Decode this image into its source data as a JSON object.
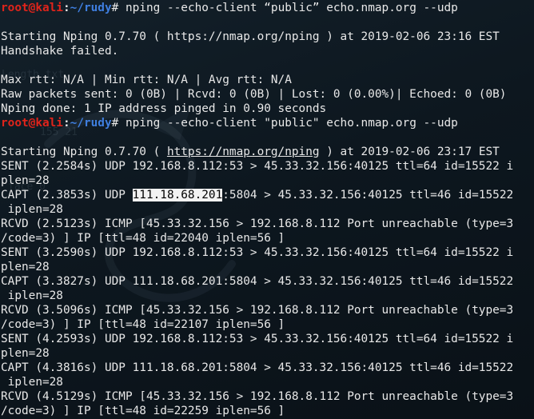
{
  "prompt": {
    "user_host": "root@kali",
    "separator": ":",
    "path": "~/rudy",
    "symbol": "# "
  },
  "session1": {
    "command": "nping --echo-client “public” echo.nmap.org --udp",
    "starting": "Starting Nping 0.7.70 ( https://nmap.org/nping ) at 2019-02-06 23:16 EST",
    "handshake": "Handshake failed.",
    "max_rtt": "Max rtt: N/A | Min rtt: N/A | Avg rtt: N/A",
    "raw_packets": "Raw packets sent: 0 (0B) | Rcvd: 0 (0B) | Lost: 0 (0.00%)| Echoed: 0 (0B)",
    "done": "Nping done: 1 IP address pinged in 0.90 seconds"
  },
  "session2": {
    "command": "nping --echo-client \"public\" echo.nmap.org --udp",
    "starting_prefix": "Starting Nping 0.7.70 ( ",
    "starting_url": "https://nmap.org/nping",
    "starting_suffix": " ) at 2019-02-06 23:17 EST",
    "sent1": "SENT (2.2584s) UDP 192.168.8.112:53 > 45.33.32.156:40125 ttl=64 id=15522 i",
    "sent1_wrap": "plen=28",
    "capt1_prefix": "CAPT (2.3853s) UDP ",
    "capt1_ip": "111.18.68.201",
    "capt1_suffix": ":5804 > 45.33.32.156:40125 ttl=46 id=15522",
    "capt1_wrap": " iplen=28",
    "rcvd1": "RCVD (2.5123s) ICMP [45.33.32.156 > 192.168.8.112 Port unreachable (type=3",
    "rcvd1_wrap": "/code=3) ] IP [ttl=48 id=22040 iplen=56 ]",
    "sent2": "SENT (3.2590s) UDP 192.168.8.112:53 > 45.33.32.156:40125 ttl=64 id=15522 i",
    "sent2_wrap": "plen=28",
    "capt2": "CAPT (3.3827s) UDP 111.18.68.201:5804 > 45.33.32.156:40125 ttl=46 id=15522",
    "capt2_wrap": " iplen=28",
    "rcvd2": "RCVD (3.5096s) ICMP [45.33.32.156 > 192.168.8.112 Port unreachable (type=3",
    "rcvd2_wrap": "/code=3) ] IP [ttl=48 id=22107 iplen=56 ]",
    "sent3": "SENT (4.2593s) UDP 192.168.8.112:53 > 45.33.32.156:40125 ttl=64 id=15522 i",
    "sent3_wrap": "plen=28",
    "capt3": "CAPT (4.3816s) UDP 111.18.68.201:5804 > 45.33.32.156:40125 ttl=46 id=15522",
    "capt3_wrap": " iplen=28",
    "rcvd3": "RCVD (4.5129s) ICMP [45.33.32.156 > 192.168.8.112 Port unreachable (type=3",
    "rcvd3_wrap": "/code=3) ] IP [ttl=48 id=22259 iplen=56 ]"
  },
  "colors": {
    "background": "#0d171f",
    "text": "#e8e8e8",
    "prompt_user": "#e0241b",
    "prompt_path": "#3f7fe0",
    "selection": "#f2f2f2"
  }
}
